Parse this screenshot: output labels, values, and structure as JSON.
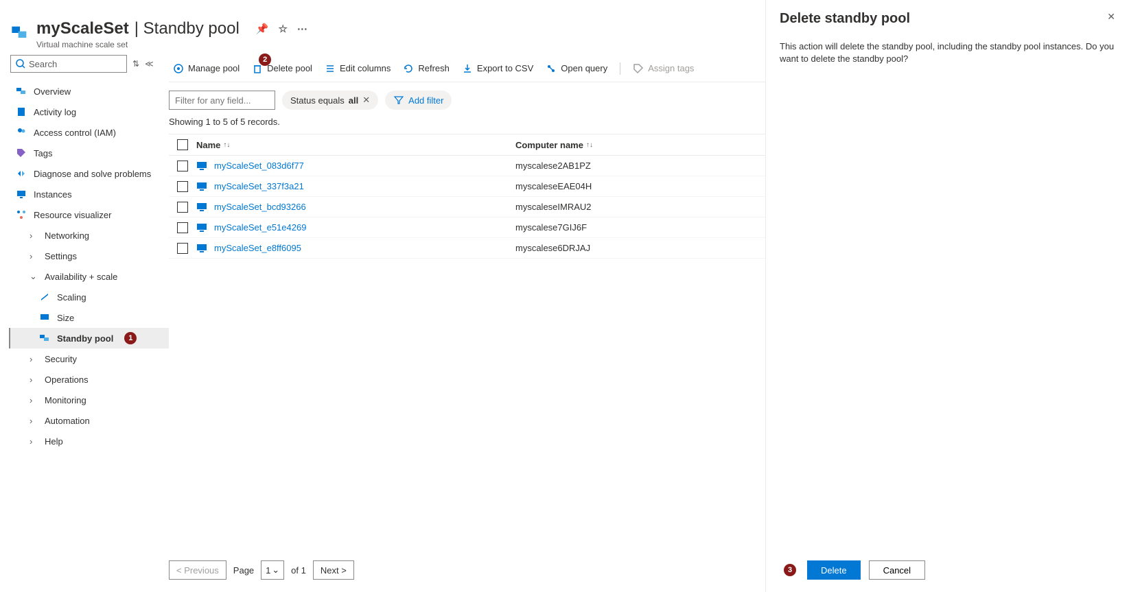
{
  "header": {
    "title_resource": "myScaleSet",
    "title_page": "Standby pool",
    "subtitle": "Virtual machine scale set"
  },
  "search": {
    "placeholder": "Search"
  },
  "nav": {
    "overview": "Overview",
    "activity": "Activity log",
    "access": "Access control (IAM)",
    "tags": "Tags",
    "diagnose": "Diagnose and solve problems",
    "instances": "Instances",
    "visualizer": "Resource visualizer",
    "networking": "Networking",
    "settings": "Settings",
    "avail": "Availability + scale",
    "scaling": "Scaling",
    "size": "Size",
    "standby": "Standby pool",
    "security": "Security",
    "operations": "Operations",
    "monitoring": "Monitoring",
    "automation": "Automation",
    "help": "Help"
  },
  "badges": {
    "b1": "1",
    "b2": "2",
    "b3": "3"
  },
  "toolbar": {
    "manage": "Manage pool",
    "delete": "Delete pool",
    "edit": "Edit columns",
    "refresh": "Refresh",
    "export": "Export to CSV",
    "query": "Open query",
    "assign": "Assign tags"
  },
  "filters": {
    "placeholder": "Filter for any field...",
    "status_pre": "Status equals ",
    "status_val": "all",
    "add": "Add filter"
  },
  "records_text": "Showing 1 to 5 of 5 records.",
  "columns": {
    "name": "Name",
    "computer": "Computer name"
  },
  "rows": [
    {
      "name": "myScaleSet_083d6f77",
      "computer": "myscalese2AB1PZ"
    },
    {
      "name": "myScaleSet_337f3a21",
      "computer": "myscaleseEAE04H"
    },
    {
      "name": "myScaleSet_bcd93266",
      "computer": "myscaleseIMRAU2"
    },
    {
      "name": "myScaleSet_e51e4269",
      "computer": "myscalese7GIJ6F"
    },
    {
      "name": "myScaleSet_e8ff6095",
      "computer": "myscalese6DRJAJ"
    }
  ],
  "pagination": {
    "prev": "< Previous",
    "page_lbl": "Page",
    "page_val": "1",
    "of": "of 1",
    "next": "Next >"
  },
  "panel": {
    "title": "Delete standby pool",
    "body": "This action will delete the standby pool, including the standby pool instances. Do you want to delete the standby pool?",
    "delete": "Delete",
    "cancel": "Cancel"
  }
}
